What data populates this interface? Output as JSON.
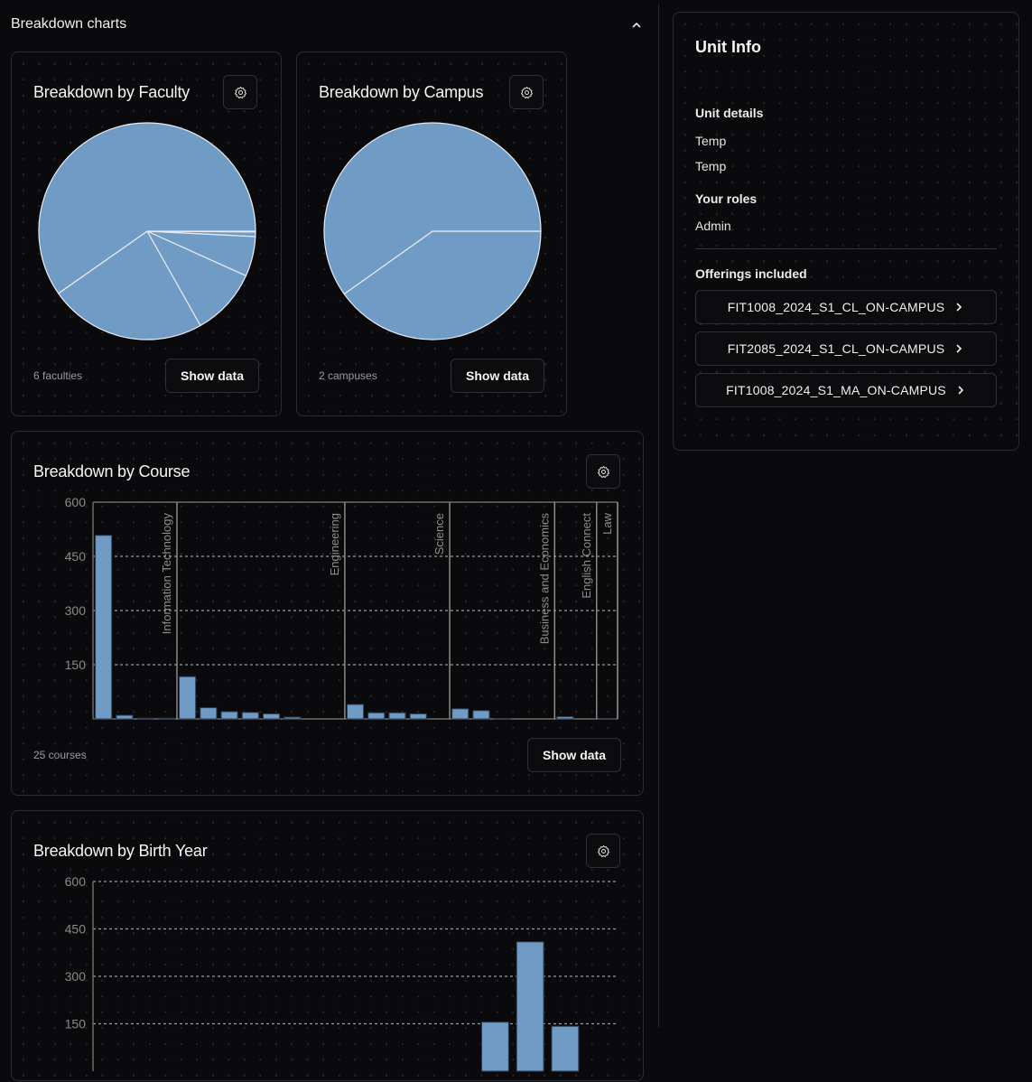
{
  "section": {
    "title": "Breakdown charts",
    "collapse_icon": "chevron-up-icon"
  },
  "faculty_card": {
    "title": "Breakdown by Faculty",
    "count_label": "6 faculties",
    "show_data_label": "Show data",
    "settings_icon": "gear-icon"
  },
  "campus_card": {
    "title": "Breakdown by Campus",
    "count_label": "2 campuses",
    "show_data_label": "Show data",
    "settings_icon": "gear-icon"
  },
  "course_card": {
    "title": "Breakdown by Course",
    "count_label": "25 courses",
    "show_data_label": "Show data",
    "settings_icon": "gear-icon"
  },
  "birth_card": {
    "title": "Breakdown by Birth Year",
    "settings_icon": "gear-icon"
  },
  "unit_info": {
    "title": "Unit Info",
    "details_heading": "Unit details",
    "details": [
      "Temp",
      "Temp"
    ],
    "roles_heading": "Your roles",
    "roles": [
      "Admin"
    ],
    "offerings_heading": "Offerings included",
    "offerings": [
      "FIT1008_2024_S1_CL_ON-CAMPUS",
      "FIT2085_2024_S1_CL_ON-CAMPUS",
      "FIT1008_2024_S1_MA_ON-CAMPUS"
    ],
    "offering_icon": "chevron-right-icon"
  },
  "colors": {
    "bar": "#6f9bc4",
    "slice_stroke": "#e8ecf2",
    "background": "#0a0a0c"
  },
  "chart_data": [
    {
      "type": "pie",
      "title": "Breakdown by Faculty",
      "labels": [
        "Law",
        "English Connect",
        "Business and Economics",
        "Science",
        "Engineering",
        "Information Technology"
      ],
      "values": [
        1,
        6,
        52,
        88,
        205,
        522
      ]
    },
    {
      "type": "pie",
      "title": "Breakdown by Campus",
      "labels": [
        "",
        ""
      ],
      "values": [
        351,
        523
      ]
    },
    {
      "type": "bar",
      "title": "Breakdown by Course",
      "xlabel": "",
      "ylabel": "",
      "ylim": [
        0,
        600
      ],
      "yticks": [
        150,
        300,
        450,
        600
      ],
      "grid": true,
      "groups": [
        {
          "name": "Information Technology",
          "values": [
            508,
            10,
            2,
            2
          ]
        },
        {
          "name": "Engineering",
          "values": [
            117,
            31,
            20,
            18,
            14,
            5,
            0,
            0
          ]
        },
        {
          "name": "Science",
          "values": [
            40,
            17,
            17,
            14,
            0
          ]
        },
        {
          "name": "Business and Economics",
          "values": [
            28,
            23,
            1,
            0,
            0
          ]
        },
        {
          "name": "English Connect",
          "values": [
            6,
            0
          ]
        },
        {
          "name": "Law",
          "values": [
            1
          ]
        }
      ]
    },
    {
      "type": "bar",
      "title": "Breakdown by Birth Year",
      "xlabel": "",
      "ylabel": "",
      "ylim": [
        0,
        600
      ],
      "yticks": [
        150,
        300,
        450,
        600
      ],
      "grid": true,
      "values": [
        null,
        null,
        null,
        null,
        null,
        null,
        null,
        null,
        null,
        null,
        null,
        155,
        409,
        142,
        null
      ]
    }
  ]
}
